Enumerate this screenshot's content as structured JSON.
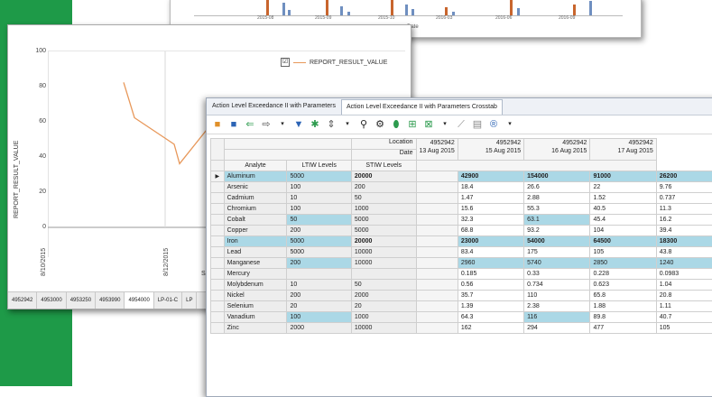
{
  "colors": {
    "background_accent": "#1e9a48",
    "highlight": "#abd8e6",
    "series_orange": "#c8652d",
    "series_blue": "#6f8fc0",
    "line_series": "#e8985a"
  },
  "top_chart": {
    "x_ticks": [
      "2015-08",
      "2015-09",
      "2015-10",
      "2016-03",
      "2016-06",
      "2016-09"
    ],
    "x_title": "Date"
  },
  "line_chart": {
    "y_axis_label": "REPORT_RESULT_VALUE",
    "y_ticks": [
      "100",
      "80",
      "60",
      "40",
      "20",
      "0"
    ],
    "x_ticks": [
      "8/10/2015",
      "8/12/2015"
    ],
    "x_title_partial": "SA",
    "legend_label": "REPORT_RESULT_VALUE",
    "legend_checkbox": "☑",
    "sheet_tabs": [
      "4952942",
      "4953000",
      "4953250",
      "4953990",
      "4954000",
      "LP-01-C",
      "LP"
    ]
  },
  "chart_data": {
    "type": "line",
    "title": "",
    "xlabel": "",
    "ylabel": "REPORT_RESULT_VALUE",
    "ylim": [
      0,
      100
    ],
    "series": [
      {
        "name": "REPORT_RESULT_VALUE",
        "x": [
          "8/10/2015",
          "8/11/2015",
          "8/12/2015",
          "8/12/2015",
          "8/13/2015"
        ],
        "values": [
          82,
          62,
          47,
          36,
          59
        ]
      }
    ],
    "legend": "top-right",
    "grid": true
  },
  "crosstab": {
    "tabs": [
      "Action Level Exceedance II with Parameters",
      "Action Level Exceedance II with Parameters Crosstab"
    ],
    "active_tab": 1,
    "toolbar_icons": [
      "folder-icon",
      "save-icon",
      "back-arrow-icon",
      "export-icon",
      "dropdown-caret-icon",
      "filter-icon",
      "pin-icon",
      "sort-icon",
      "dropdown-caret-icon",
      "search-icon",
      "gear-icon",
      "database-icon",
      "table-icon",
      "chart-icon",
      "dropdown-caret-icon",
      "line-chart-icon",
      "bar-chart-icon",
      "r-icon",
      "dropdown-caret-icon"
    ],
    "header": {
      "location_label": "Location",
      "date_label": "Date",
      "analyte_label": "Analyte",
      "ltiw_label": "LTIW Levels",
      "stiw_label": "STIW Levels",
      "columns": [
        {
          "location": "4952942",
          "date": "13 Aug 2015"
        },
        {
          "location": "4952942",
          "date": "15 Aug 2015"
        },
        {
          "location": "4952942",
          "date": "16 Aug 2015"
        },
        {
          "location": "4952942",
          "date": "17 Aug 2015"
        }
      ]
    },
    "rows": [
      {
        "analyte": "Aluminum",
        "ltiw": "5000",
        "stiw": "20000",
        "values": [
          "42900",
          "154000",
          "91000",
          "26200"
        ],
        "hl": [
          true,
          true,
          true,
          true
        ],
        "bold": true,
        "selected": true
      },
      {
        "analyte": "Arsenic",
        "ltiw": "100",
        "stiw": "200",
        "values": [
          "18.4",
          "26.6",
          "22",
          "9.76"
        ],
        "hl": [
          false,
          false,
          false,
          false
        ]
      },
      {
        "analyte": "Cadmium",
        "ltiw": "10",
        "stiw": "50",
        "values": [
          "1.47",
          "2.88",
          "1.52",
          "0.737"
        ],
        "hl": [
          false,
          false,
          false,
          false
        ]
      },
      {
        "analyte": "Chromium",
        "ltiw": "100",
        "stiw": "1000",
        "values": [
          "15.6",
          "55.3",
          "40.5",
          "11.3"
        ],
        "hl": [
          false,
          false,
          false,
          false
        ]
      },
      {
        "analyte": "Cobalt",
        "ltiw": "50",
        "stiw": "5000",
        "values": [
          "32.3",
          "63.1",
          "45.4",
          "16.2"
        ],
        "hl": [
          false,
          true,
          false,
          false
        ],
        "ltiw_hl": true
      },
      {
        "analyte": "Copper",
        "ltiw": "200",
        "stiw": "5000",
        "values": [
          "68.8",
          "93.2",
          "104",
          "39.4"
        ],
        "hl": [
          false,
          false,
          false,
          false
        ]
      },
      {
        "analyte": "Iron",
        "ltiw": "5000",
        "stiw": "20000",
        "values": [
          "23000",
          "54000",
          "64500",
          "18300"
        ],
        "hl": [
          true,
          true,
          true,
          true
        ],
        "bold": true,
        "row_hl": true
      },
      {
        "analyte": "Lead",
        "ltiw": "5000",
        "stiw": "10000",
        "values": [
          "83.4",
          "175",
          "105",
          "43.8"
        ],
        "hl": [
          false,
          false,
          false,
          false
        ]
      },
      {
        "analyte": "Manganese",
        "ltiw": "200",
        "stiw": "10000",
        "values": [
          "2960",
          "5740",
          "2850",
          "1240"
        ],
        "hl": [
          true,
          true,
          true,
          true
        ],
        "ltiw_hl": true
      },
      {
        "analyte": "Mercury",
        "ltiw": "",
        "stiw": "",
        "values": [
          "0.185",
          "0.33",
          "0.228",
          "0.0983"
        ],
        "hl": [
          false,
          false,
          false,
          false
        ]
      },
      {
        "analyte": "Molybdenum",
        "ltiw": "10",
        "stiw": "50",
        "values": [
          "0.56",
          "0.734",
          "0.623",
          "1.04"
        ],
        "hl": [
          false,
          false,
          false,
          false
        ]
      },
      {
        "analyte": "Nickel",
        "ltiw": "200",
        "stiw": "2000",
        "values": [
          "35.7",
          "110",
          "65.8",
          "20.8"
        ],
        "hl": [
          false,
          false,
          false,
          false
        ]
      },
      {
        "analyte": "Selenium",
        "ltiw": "20",
        "stiw": "20",
        "values": [
          "1.39",
          "2.38",
          "1.88",
          "1.11"
        ],
        "hl": [
          false,
          false,
          false,
          false
        ]
      },
      {
        "analyte": "Vanadium",
        "ltiw": "100",
        "stiw": "1000",
        "values": [
          "64.3",
          "116",
          "89.8",
          "40.7"
        ],
        "hl": [
          false,
          true,
          false,
          false
        ],
        "ltiw_hl": true
      },
      {
        "analyte": "Zinc",
        "ltiw": "2000",
        "stiw": "10000",
        "values": [
          "162",
          "294",
          "477",
          "105"
        ],
        "hl": [
          false,
          false,
          false,
          false
        ]
      }
    ]
  }
}
